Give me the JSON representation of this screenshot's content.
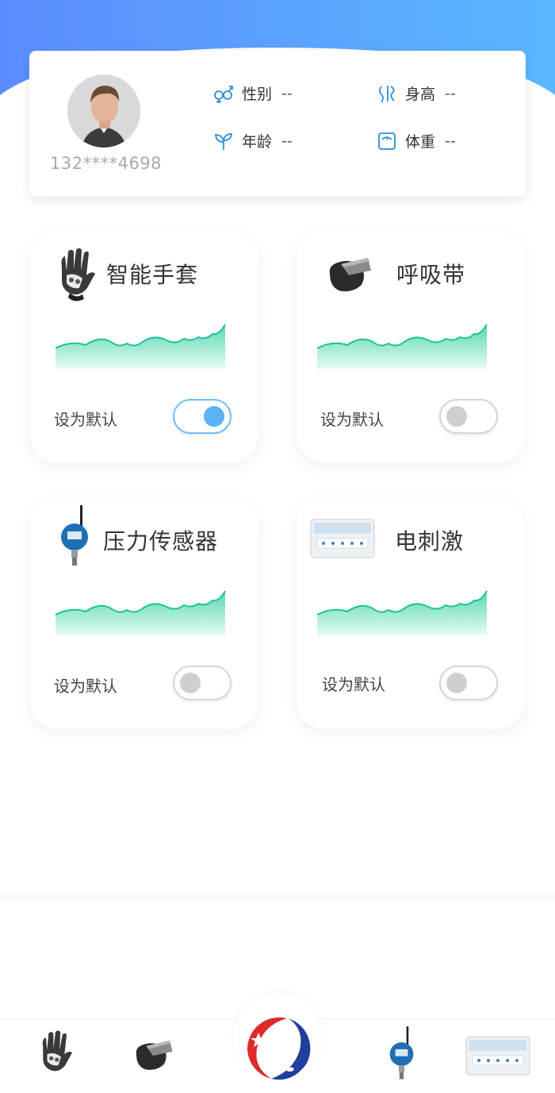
{
  "profile": {
    "phone": "132****4698",
    "gender_label": "性别",
    "gender_value": "--",
    "height_label": "身高",
    "height_value": "--",
    "age_label": "年龄",
    "age_value": "--",
    "weight_label": "体重",
    "weight_value": "--"
  },
  "devices": [
    {
      "name": "智能手套",
      "default_label": "设为默认",
      "is_default": true
    },
    {
      "name": "呼吸带",
      "default_label": "设为默认",
      "is_default": false
    },
    {
      "name": "压力传感器",
      "default_label": "设为默认",
      "is_default": false
    },
    {
      "name": "电刺激",
      "default_label": "设为默认",
      "is_default": false
    }
  ],
  "colors": {
    "header_gradient_start": "#5b8cff",
    "header_gradient_end": "#5ab7ff",
    "accent": "#5ab4f5",
    "wave_line": "#1cc39a",
    "icon_blue": "#2c8fd6"
  },
  "tabbar": {
    "items": [
      "glove-icon",
      "breathing-belt-icon",
      "app-logo",
      "pressure-sensor-icon",
      "electro-stimulator-icon"
    ]
  }
}
